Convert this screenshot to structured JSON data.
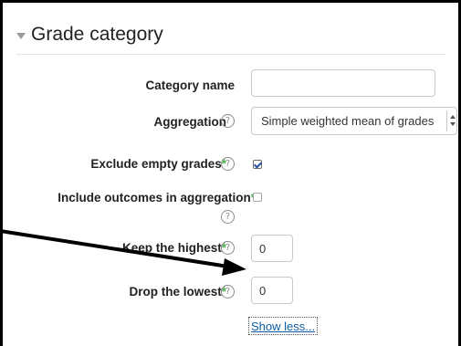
{
  "section": {
    "title": "Grade category"
  },
  "form": {
    "category_name": {
      "label": "Category name",
      "value": ""
    },
    "aggregation": {
      "label": "Aggregation",
      "selected": "Simple weighted mean of grades"
    },
    "exclude_empty": {
      "label": "Exclude empty grades",
      "required_marker": "*",
      "checked": true
    },
    "include_outcomes": {
      "label": "Include outcomes in aggregation",
      "required_marker": "*",
      "checked": false
    },
    "keep_highest": {
      "label": "Keep the highest",
      "required_marker": "*",
      "value": "0"
    },
    "drop_lowest": {
      "label": "Drop the lowest",
      "required_marker": "*",
      "value": "0"
    },
    "help_glyph": "?",
    "show_less_label": "Show less..."
  },
  "icons": {
    "legend_toggle": "triangle-down-icon",
    "help": "question-circle-icon",
    "annotation": "arrow-annotation"
  },
  "colors": {
    "required": "#4ab24a",
    "link": "#0d5ca6",
    "border": "#c9c9c9"
  }
}
